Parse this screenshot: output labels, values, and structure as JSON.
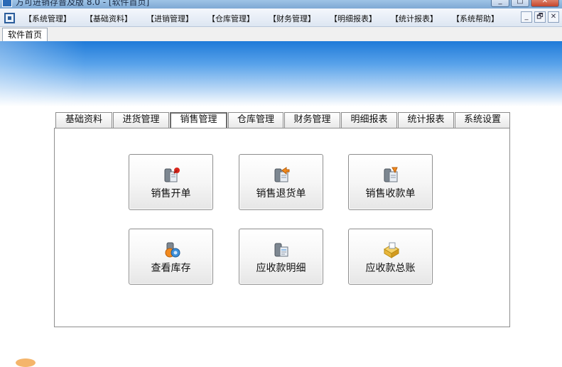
{
  "window": {
    "title": "方可进销存普及版 8.0 - [软件首页]",
    "controls": [
      "_",
      "□",
      "✕"
    ]
  },
  "menu": {
    "items": [
      "【系统管理】",
      "【基础资料】",
      "【进销管理】",
      "【仓库管理】",
      "【财务管理】",
      "【明细报表】",
      "【统计报表】",
      "【系统帮助】"
    ],
    "mdi_controls": [
      "_",
      "🗗",
      "✕"
    ]
  },
  "doc_tabs": [
    "软件首页"
  ],
  "function_tabs": [
    {
      "label": "基础资料",
      "active": false
    },
    {
      "label": "进货管理",
      "active": false
    },
    {
      "label": "销售管理",
      "active": true
    },
    {
      "label": "仓库管理",
      "active": false
    },
    {
      "label": "财务管理",
      "active": false
    },
    {
      "label": "明细报表",
      "active": false
    },
    {
      "label": "统计报表",
      "active": false
    },
    {
      "label": "系统设置",
      "active": false
    }
  ],
  "actions": [
    {
      "label": "销售开单",
      "icon": "sales-order-icon"
    },
    {
      "label": "销售退货单",
      "icon": "sales-return-icon"
    },
    {
      "label": "销售收款单",
      "icon": "sales-receipt-icon"
    },
    {
      "label": "查看库存",
      "icon": "view-stock-icon"
    },
    {
      "label": "应收款明细",
      "icon": "receivable-detail-icon"
    },
    {
      "label": "应收款总账",
      "icon": "receivable-ledger-icon"
    }
  ],
  "colors": {
    "band_top": "#1f7ad8",
    "accent_orange": "#f28a1e",
    "accent_red": "#d8261c"
  }
}
